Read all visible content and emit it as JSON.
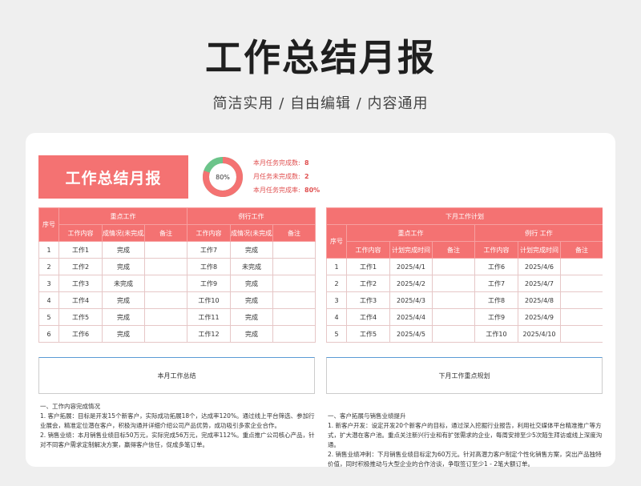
{
  "hero": {
    "title": "工作总结月报",
    "subtitle": "简洁实用 / 自由编辑 / 内容通用"
  },
  "banner": {
    "title": "工作总结月报"
  },
  "donut": {
    "percent_label": "80%",
    "fraction": 0.8,
    "colors": {
      "done": "#f47272",
      "remain": "#6cc48a"
    }
  },
  "stats": [
    {
      "label": "本月任务完成数:",
      "value": "8"
    },
    {
      "label": "月任务未完成数:",
      "value": "2"
    },
    {
      "label": "本月任务完成率:",
      "value": "80%"
    }
  ],
  "left_table": {
    "col_index": "序号",
    "group_key": "重点工作",
    "group_routine": "例行工作",
    "sub_headers": [
      "工作内容",
      "成情况(未完成原)",
      "备注",
      "工作内容",
      "成情况(未完成原)",
      "备注"
    ],
    "rows": [
      {
        "n": "1",
        "k_task": "工作1",
        "k_status": "完成",
        "k_note": "",
        "r_task": "工作7",
        "r_status": "完成",
        "r_note": ""
      },
      {
        "n": "2",
        "k_task": "工作2",
        "k_status": "完成",
        "k_note": "",
        "r_task": "工作8",
        "r_status": "未完成",
        "r_note": ""
      },
      {
        "n": "3",
        "k_task": "工作3",
        "k_status": "未完成",
        "k_note": "",
        "r_task": "工作9",
        "r_status": "完成",
        "r_note": ""
      },
      {
        "n": "4",
        "k_task": "工作4",
        "k_status": "完成",
        "k_note": "",
        "r_task": "工作10",
        "r_status": "完成",
        "r_note": ""
      },
      {
        "n": "5",
        "k_task": "工作5",
        "k_status": "完成",
        "k_note": "",
        "r_task": "工作11",
        "r_status": "完成",
        "r_note": ""
      },
      {
        "n": "6",
        "k_task": "工作6",
        "k_status": "完成",
        "k_note": "",
        "r_task": "工作12",
        "r_status": "完成",
        "r_note": ""
      }
    ]
  },
  "right_table": {
    "title": "下月工作计划",
    "col_index": "序号",
    "group_key": "重点工作",
    "group_routine": "例行 工作",
    "sub_headers": [
      "工作内容",
      "计划完成时间",
      "备注",
      "工作内容",
      "计划完成时间",
      "备注"
    ],
    "rows": [
      {
        "n": "1",
        "k_task": "工作1",
        "k_date": "2025/4/1",
        "k_note": "",
        "r_task": "工作6",
        "r_date": "2025/4/6",
        "r_note": ""
      },
      {
        "n": "2",
        "k_task": "工作2",
        "k_date": "2025/4/2",
        "k_note": "",
        "r_task": "工作7",
        "r_date": "2025/4/7",
        "r_note": ""
      },
      {
        "n": "3",
        "k_task": "工作3",
        "k_date": "2025/4/3",
        "k_note": "",
        "r_task": "工作8",
        "r_date": "2025/4/8",
        "r_note": ""
      },
      {
        "n": "4",
        "k_task": "工作4",
        "k_date": "2025/4/4",
        "k_note": "",
        "r_task": "工作9",
        "r_date": "2025/4/9",
        "r_note": ""
      },
      {
        "n": "5",
        "k_task": "工作5",
        "k_date": "2025/4/5",
        "k_note": "",
        "r_task": "工作10",
        "r_date": "2025/4/10",
        "r_note": ""
      }
    ]
  },
  "summary_left": {
    "title": "本月工作总结",
    "heading": "一、工作内容完成情况",
    "p1": "1. 客户拓展：目标是开发15个新客户，实际成功拓展18个，达成率120%。通过线上平台筛选、参加行业展会，精准定位潜在客户，积极沟通并详细介绍公司产品优势，成功吸引多家企业合作。",
    "p2": "2. 销售业绩：本月销售业绩目标50万元，实际完成56万元，完成率112%。重点推广公司核心产品，针对不同客户需求定制解决方案，赢得客户信任，促成多笔订单。"
  },
  "summary_right": {
    "title": "下月工作重点规划",
    "heading": "一、客户拓展与销售业绩提升",
    "p1": "1. 新客户开发：设定开发20个新客户的目标，通过深入挖掘行业报告，利用社交媒体平台精准推广等方式，扩大潜在客户池。重点关注新兴行业和有扩张需求的企业，每周安排至少5次陌生拜访或线上深度沟通。",
    "p2": "2. 销售业绩冲刺：下月销售业绩目标定为60万元。针对高潜力客户制定个性化销售方案，突出产品独特价值，同时积极推动与大型企业的合作洽谈，争取签订至少1 - 2笔大额订单。"
  }
}
